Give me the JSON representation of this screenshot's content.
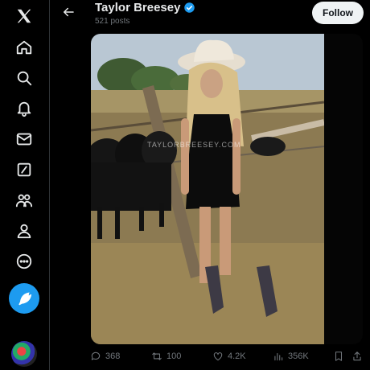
{
  "profile": {
    "name": "Taylor Breesey",
    "posts_count": "521 posts",
    "follow_label": "Follow"
  },
  "photo": {
    "watermark": "TAYLORBREESEY.COM"
  },
  "actions": {
    "replies": "368",
    "reposts": "100",
    "likes": "4.2K",
    "views": "356K"
  },
  "colors": {
    "accent": "#1d9bf0",
    "background": "#000000",
    "muted": "#71767b"
  },
  "sidebar_icons": [
    "x-logo-icon",
    "home-icon",
    "search-icon",
    "notifications-icon",
    "messages-icon",
    "grok-icon",
    "communities-icon",
    "profile-icon",
    "more-icon"
  ]
}
